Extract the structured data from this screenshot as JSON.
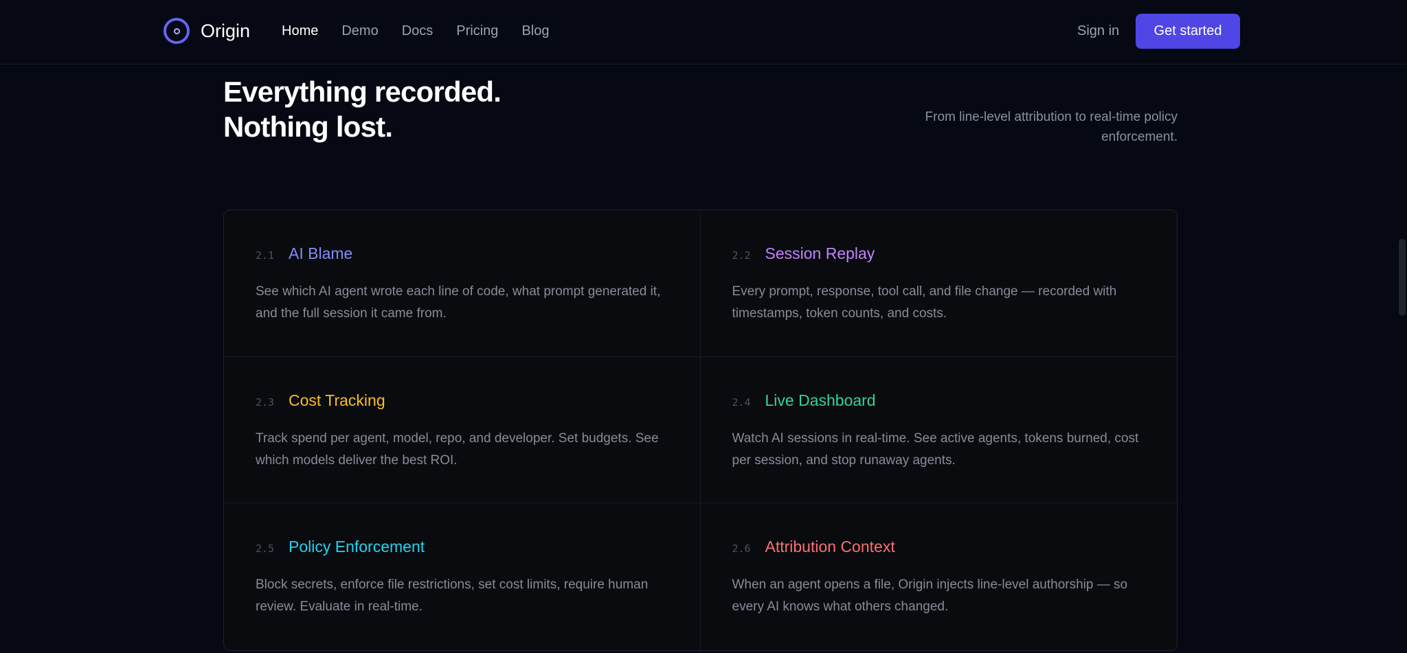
{
  "nav": {
    "brand": "Origin",
    "links": [
      "Home",
      "Demo",
      "Docs",
      "Pricing",
      "Blog"
    ],
    "sign_in": "Sign in",
    "cta": "Get started"
  },
  "hero": {
    "title_line1": "Everything recorded.",
    "title_line2": "Nothing lost.",
    "subtitle": "From line-level attribution to real-time policy enforcement."
  },
  "features": [
    {
      "num": "2.1",
      "title": "AI Blame",
      "color": "#818cf8",
      "desc": "See which AI agent wrote each line of code, what prompt generated it, and the full session it came from."
    },
    {
      "num": "2.2",
      "title": "Session Replay",
      "color": "#c084fc",
      "desc": "Every prompt, response, tool call, and file change — recorded with timestamps, token counts, and costs."
    },
    {
      "num": "2.3",
      "title": "Cost Tracking",
      "color": "#fbbf24",
      "desc": "Track spend per agent, model, repo, and developer. Set budgets. See which models deliver the best ROI."
    },
    {
      "num": "2.4",
      "title": "Live Dashboard",
      "color": "#34d399",
      "desc": "Watch AI sessions in real-time. See active agents, tokens burned, cost per session, and stop runaway agents."
    },
    {
      "num": "2.5",
      "title": "Policy Enforcement",
      "color": "#22d3ee",
      "desc": "Block secrets, enforce file restrictions, set cost limits, require human review. Evaluate in real-time."
    },
    {
      "num": "2.6",
      "title": "Attribution Context",
      "color": "#f87171",
      "desc": "When an agent opens a file, Origin injects line-level authorship — so every AI knows what others changed."
    }
  ],
  "colors": {
    "accent": "#4f46e5",
    "background": "#060913"
  }
}
